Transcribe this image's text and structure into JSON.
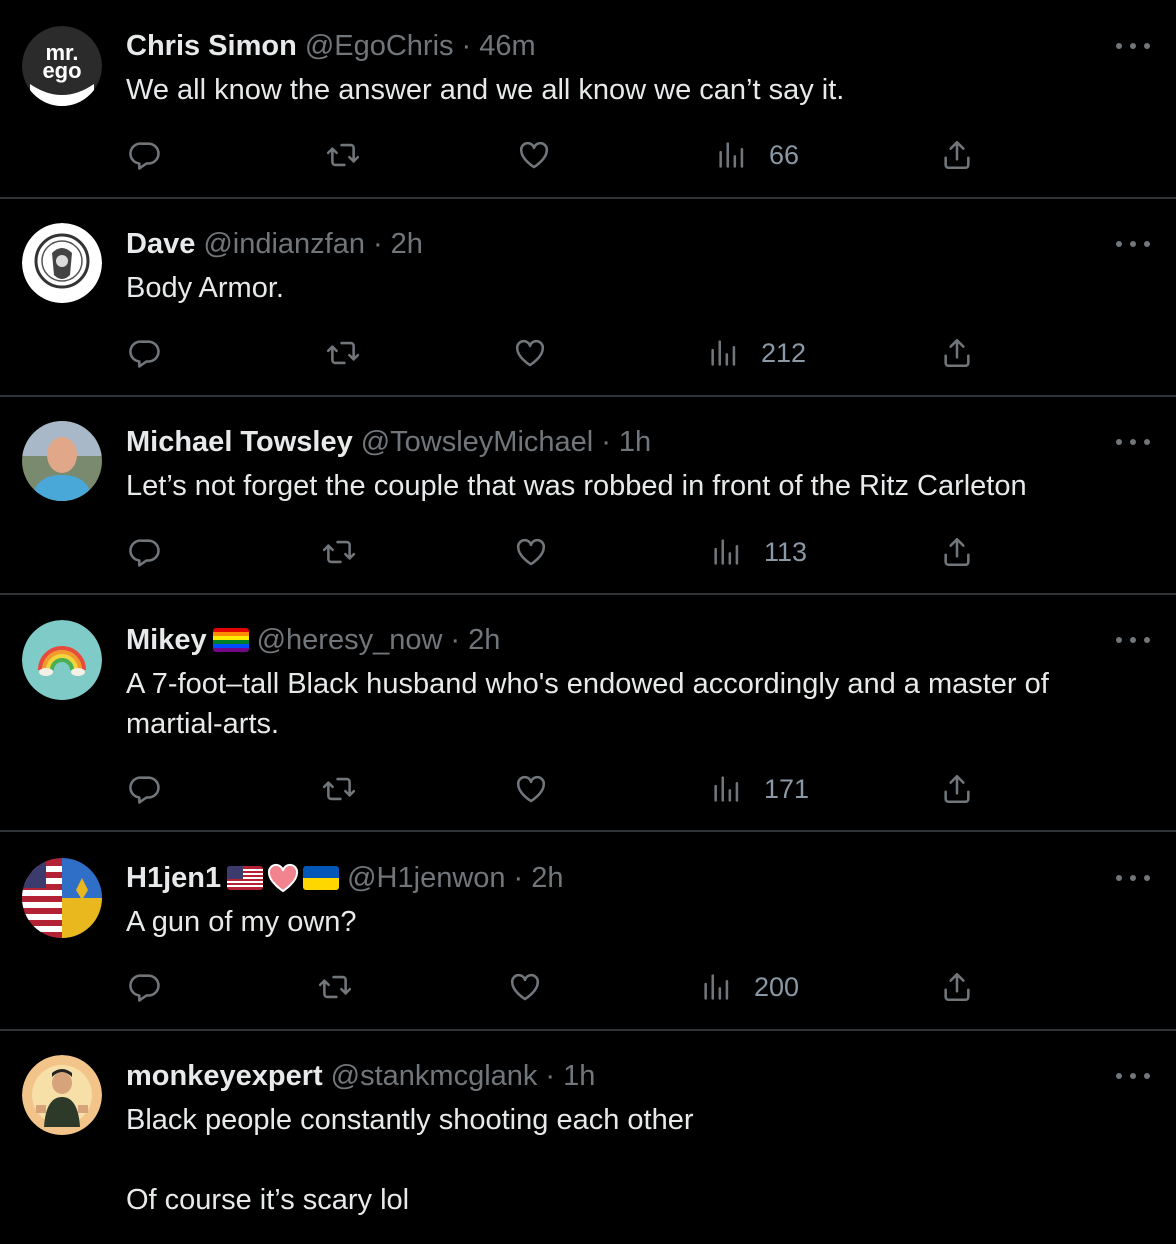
{
  "tweets": [
    {
      "name": "Chris Simon",
      "handle": "@EgoChris",
      "time": "46m",
      "text": [
        "We all know the answer and we all know we can’t say it."
      ],
      "views": "66",
      "avatar_text": [
        "mr.",
        "ego"
      ]
    },
    {
      "name": "Dave",
      "handle": "@indianzfan",
      "time": "2h",
      "text": [
        "Body Armor."
      ],
      "views": "212"
    },
    {
      "name": "Michael Towsley",
      "handle": "@TowsleyMichael",
      "time": "1h",
      "text": [
        "Let’s not forget the couple that was robbed in front of the Ritz Carleton"
      ],
      "views": "113"
    },
    {
      "name": "Mikey",
      "handle": "@heresy_now",
      "time": "2h",
      "text": [
        "A 7-foot–tall Black husband who's endowed accordingly and a master of martial-arts."
      ],
      "views": "171",
      "name_emojis": [
        "rainbow-flag"
      ]
    },
    {
      "name": "H1jen1",
      "handle": "@H1jenwon",
      "time": "2h",
      "text": [
        "A gun of my own?"
      ],
      "views": "200",
      "name_emojis": [
        "us-flag",
        "heart",
        "ukraine-flag"
      ]
    },
    {
      "name": "monkeyexpert",
      "handle": "@stankmcglank",
      "time": "1h",
      "text": [
        "Black people constantly shooting each other",
        "Of course it’s scary lol"
      ]
    }
  ],
  "icons": {
    "reply": "reply-icon",
    "retweet": "retweet-icon",
    "like": "like-icon",
    "views": "views-icon",
    "share": "share-icon",
    "more": "more-icon"
  },
  "colors": {
    "background": "#000000",
    "text": "#e7e9ea",
    "secondary": "#71767b",
    "divider": "#2f3336"
  }
}
